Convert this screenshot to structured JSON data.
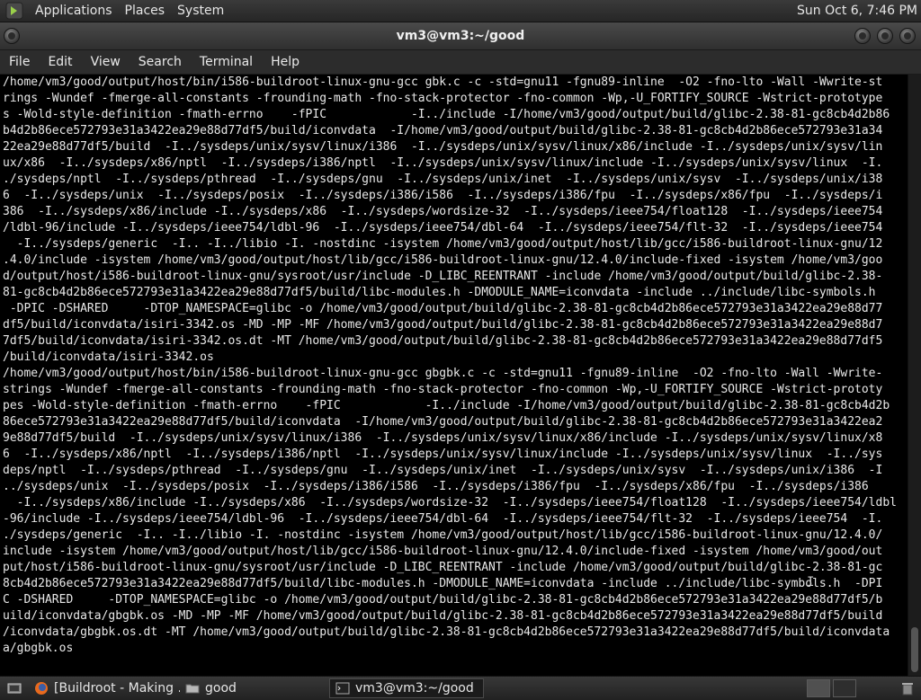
{
  "top_panel": {
    "menus": [
      "Applications",
      "Places",
      "System"
    ],
    "clock": "Sun Oct  6,  7:46 PM"
  },
  "window": {
    "title": "vm3@vm3:~/good",
    "menu": [
      "File",
      "Edit",
      "View",
      "Search",
      "Terminal",
      "Help"
    ]
  },
  "terminal": {
    "lines": [
      "/home/vm3/good/output/host/bin/i586-buildroot-linux-gnu-gcc gbk.c -c -std=gnu11 -fgnu89-inline  -O2 -fno-lto -Wall -Wwrite-st",
      "rings -Wundef -fmerge-all-constants -frounding-math -fno-stack-protector -fno-common -Wp,-U_FORTIFY_SOURCE -Wstrict-prototype",
      "s -Wold-style-definition -fmath-errno    -fPIC            -I../include -I/home/vm3/good/output/build/glibc-2.38-81-gc8cb4d2b86",
      "b4d2b86ece572793e31a3422ea29e88d77df5/build/iconvdata  -I/home/vm3/good/output/build/glibc-2.38-81-gc8cb4d2b86ece572793e31a34",
      "22ea29e88d77df5/build  -I../sysdeps/unix/sysv/linux/i386  -I../sysdeps/unix/sysv/linux/x86/include -I../sysdeps/unix/sysv/lin",
      "ux/x86  -I../sysdeps/x86/nptl  -I../sysdeps/i386/nptl  -I../sysdeps/unix/sysv/linux/include -I../sysdeps/unix/sysv/linux  -I.",
      "./sysdeps/nptl  -I../sysdeps/pthread  -I../sysdeps/gnu  -I../sysdeps/unix/inet  -I../sysdeps/unix/sysv  -I../sysdeps/unix/i38",
      "6  -I../sysdeps/unix  -I../sysdeps/posix  -I../sysdeps/i386/i586  -I../sysdeps/i386/fpu  -I../sysdeps/x86/fpu  -I../sysdeps/i",
      "386  -I../sysdeps/x86/include -I../sysdeps/x86  -I../sysdeps/wordsize-32  -I../sysdeps/ieee754/float128  -I../sysdeps/ieee754",
      "/ldbl-96/include -I../sysdeps/ieee754/ldbl-96  -I../sysdeps/ieee754/dbl-64  -I../sysdeps/ieee754/flt-32  -I../sysdeps/ieee754",
      "  -I../sysdeps/generic  -I.. -I../libio -I. -nostdinc -isystem /home/vm3/good/output/host/lib/gcc/i586-buildroot-linux-gnu/12",
      ".4.0/include -isystem /home/vm3/good/output/host/lib/gcc/i586-buildroot-linux-gnu/12.4.0/include-fixed -isystem /home/vm3/goo",
      "d/output/host/i586-buildroot-linux-gnu/sysroot/usr/include -D_LIBC_REENTRANT -include /home/vm3/good/output/build/glibc-2.38-",
      "81-gc8cb4d2b86ece572793e31a3422ea29e88d77df5/build/libc-modules.h -DMODULE_NAME=iconvdata -include ../include/libc-symbols.h",
      " -DPIC -DSHARED     -DTOP_NAMESPACE=glibc -o /home/vm3/good/output/build/glibc-2.38-81-gc8cb4d2b86ece572793e31a3422ea29e88d77",
      "df5/build/iconvdata/isiri-3342.os -MD -MP -MF /home/vm3/good/output/build/glibc-2.38-81-gc8cb4d2b86ece572793e31a3422ea29e88d7",
      "7df5/build/iconvdata/isiri-3342.os.dt -MT /home/vm3/good/output/build/glibc-2.38-81-gc8cb4d2b86ece572793e31a3422ea29e88d77df5",
      "/build/iconvdata/isiri-3342.os",
      "/home/vm3/good/output/host/bin/i586-buildroot-linux-gnu-gcc gbgbk.c -c -std=gnu11 -fgnu89-inline  -O2 -fno-lto -Wall -Wwrite-",
      "strings -Wundef -fmerge-all-constants -frounding-math -fno-stack-protector -fno-common -Wp,-U_FORTIFY_SOURCE -Wstrict-prototy",
      "pes -Wold-style-definition -fmath-errno    -fPIC            -I../include -I/home/vm3/good/output/build/glibc-2.38-81-gc8cb4d2b",
      "86ece572793e31a3422ea29e88d77df5/build/iconvdata  -I/home/vm3/good/output/build/glibc-2.38-81-gc8cb4d2b86ece572793e31a3422ea2",
      "9e88d77df5/build  -I../sysdeps/unix/sysv/linux/i386  -I../sysdeps/unix/sysv/linux/x86/include -I../sysdeps/unix/sysv/linux/x8",
      "6  -I../sysdeps/x86/nptl  -I../sysdeps/i386/nptl  -I../sysdeps/unix/sysv/linux/include -I../sysdeps/unix/sysv/linux  -I../sys",
      "deps/nptl  -I../sysdeps/pthread  -I../sysdeps/gnu  -I../sysdeps/unix/inet  -I../sysdeps/unix/sysv  -I../sysdeps/unix/i386  -I",
      "../sysdeps/unix  -I../sysdeps/posix  -I../sysdeps/i386/i586  -I../sysdeps/i386/fpu  -I../sysdeps/x86/fpu  -I../sysdeps/i386",
      "  -I../sysdeps/x86/include -I../sysdeps/x86  -I../sysdeps/wordsize-32  -I../sysdeps/ieee754/float128  -I../sysdeps/ieee754/ldbl",
      "-96/include -I../sysdeps/ieee754/ldbl-96  -I../sysdeps/ieee754/dbl-64  -I../sysdeps/ieee754/flt-32  -I../sysdeps/ieee754  -I.",
      "./sysdeps/generic  -I.. -I../libio -I. -nostdinc -isystem /home/vm3/good/output/host/lib/gcc/i586-buildroot-linux-gnu/12.4.0/",
      "include -isystem /home/vm3/good/output/host/lib/gcc/i586-buildroot-linux-gnu/12.4.0/include-fixed -isystem /home/vm3/good/out",
      "put/host/i586-buildroot-linux-gnu/sysroot/usr/include -D_LIBC_REENTRANT -include /home/vm3/good/output/build/glibc-2.38-81-gc",
      "8cb4d2b86ece572793e31a3422ea29e88d77df5/build/libc-modules.h -DMODULE_NAME=iconvdata -include ../include/libc-symbols.h  -DPI",
      "C -DSHARED     -DTOP_NAMESPACE=glibc -o /home/vm3/good/output/build/glibc-2.38-81-gc8cb4d2b86ece572793e31a3422ea29e88d77df5/b",
      "uild/iconvdata/gbgbk.os -MD -MP -MF /home/vm3/good/output/build/glibc-2.38-81-gc8cb4d2b86ece572793e31a3422ea29e88d77df5/build",
      "/iconvdata/gbgbk.os.dt -MT /home/vm3/good/output/build/glibc-2.38-81-gc8cb4d2b86ece572793e31a3422ea29e88d77df5/build/iconvdata",
      "a/gbgbk.os"
    ]
  },
  "taskbar": {
    "tasks": [
      {
        "label": "[Buildroot - Making ...",
        "icon": "firefox-icon"
      },
      {
        "label": "good",
        "icon": "folder-icon"
      },
      {
        "label": "vm3@vm3:~/good",
        "icon": "terminal-icon"
      }
    ]
  }
}
